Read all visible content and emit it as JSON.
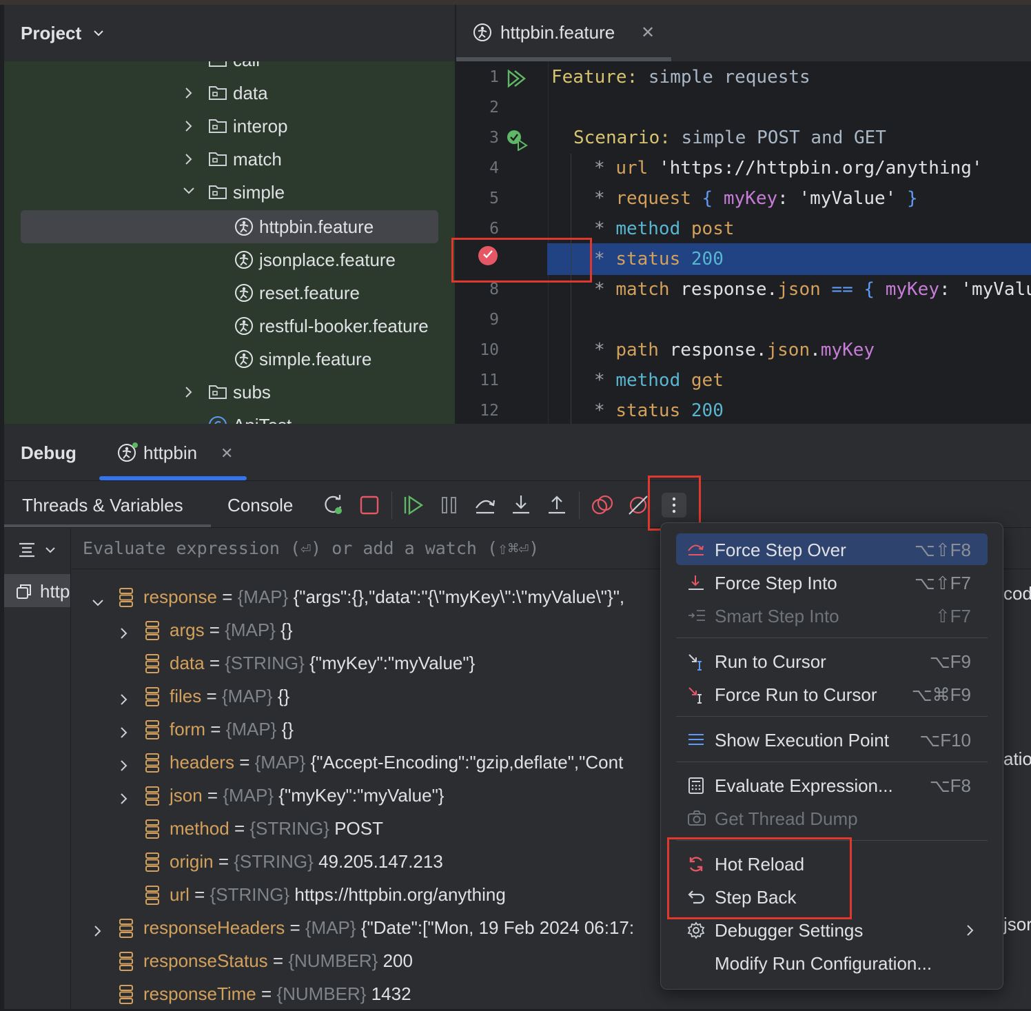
{
  "project": {
    "title": "Project",
    "tree": [
      {
        "label": "call",
        "kind": "folder",
        "clipped": true
      },
      {
        "label": "data",
        "kind": "folder",
        "expanded": false
      },
      {
        "label": "interop",
        "kind": "folder",
        "expanded": false
      },
      {
        "label": "match",
        "kind": "folder",
        "expanded": false
      },
      {
        "label": "simple",
        "kind": "folder",
        "expanded": true
      },
      {
        "label": "httpbin.feature",
        "kind": "feature",
        "selected": true
      },
      {
        "label": "jsonplace.feature",
        "kind": "feature"
      },
      {
        "label": "reset.feature",
        "kind": "feature"
      },
      {
        "label": "restful-booker.feature",
        "kind": "feature"
      },
      {
        "label": "simple.feature",
        "kind": "feature"
      },
      {
        "label": "subs",
        "kind": "folder",
        "expanded": false
      },
      {
        "label": "ApiTest",
        "kind": "class",
        "clipped": true
      }
    ]
  },
  "editor": {
    "tab_label": "httpbin.feature",
    "lines": [
      {
        "n": "1",
        "text": "Feature: simple requests"
      },
      {
        "n": "2",
        "text": ""
      },
      {
        "n": "3",
        "text": "Scenario: simple POST and GET"
      },
      {
        "n": "4",
        "text": "* url 'https://httpbin.org/anything'"
      },
      {
        "n": "5",
        "text": "* request { myKey: 'myValue' }"
      },
      {
        "n": "6",
        "text": "* method post"
      },
      {
        "n": "7",
        "text": "* status 200"
      },
      {
        "n": "8",
        "text": "* match response.json == { myKey: 'myValu"
      },
      {
        "n": "9",
        "text": ""
      },
      {
        "n": "10",
        "text": "* path response.json.myKey"
      },
      {
        "n": "11",
        "text": "* method get"
      },
      {
        "n": "12",
        "text": "* status 200"
      }
    ],
    "tokens": {
      "feature_kw": "Feature:",
      "feature_name": " simple requests",
      "scenario_kw": "Scenario:",
      "scenario_name": " simple POST and GET",
      "star": "*",
      "url": "url",
      "url_val": "'https://httpbin.org/anything'",
      "request": "request",
      "lbrace": "{",
      "rbrace": "}",
      "mykey": "myKey",
      "colon": ":",
      "myvalue": "'myValue'",
      "method": "method",
      "post": "post",
      "get": "get",
      "status": "status",
      "s200": "200",
      "match": "match",
      "response": "response",
      "dot": ".",
      "json": "json",
      "eqeq": "==",
      "myvalu": "'myValu",
      "path": "path",
      "mykey2": "myKey"
    },
    "highlighted_line": "7"
  },
  "debug": {
    "title": "Debug",
    "session_tab": "httpbin",
    "tabs": [
      "Threads & Variables",
      "Console"
    ],
    "eval_placeholder": "Evaluate expression (⏎) or add a watch (⇧⌘⏎)",
    "frame_label": "http",
    "variables": [
      {
        "name": "response",
        "type": "{MAP}",
        "value": "{\"args\":{},\"data\":\"{\\\"myKey\\\":\\\"myValue\\\"}\",",
        "level": 0,
        "expandable": true,
        "expanded": true
      },
      {
        "name": "args",
        "type": "{MAP}",
        "value": "{}",
        "level": 1,
        "expandable": true
      },
      {
        "name": "data",
        "type": "{STRING}",
        "value": "{\"myKey\":\"myValue\"}",
        "level": 1,
        "expandable": false
      },
      {
        "name": "files",
        "type": "{MAP}",
        "value": "{}",
        "level": 1,
        "expandable": true
      },
      {
        "name": "form",
        "type": "{MAP}",
        "value": "{}",
        "level": 1,
        "expandable": true
      },
      {
        "name": "headers",
        "type": "{MAP}",
        "value": "{\"Accept-Encoding\":\"gzip,deflate\",\"Cont",
        "level": 1,
        "expandable": true
      },
      {
        "name": "json",
        "type": "{MAP}",
        "value": "{\"myKey\":\"myValue\"}",
        "level": 1,
        "expandable": true
      },
      {
        "name": "method",
        "type": "{STRING}",
        "value": "POST",
        "level": 1,
        "expandable": false
      },
      {
        "name": "origin",
        "type": "{STRING}",
        "value": "49.205.147.213",
        "level": 1,
        "expandable": false
      },
      {
        "name": "url",
        "type": "{STRING}",
        "value": "https://httpbin.org/anything",
        "level": 1,
        "expandable": false
      },
      {
        "name": "responseHeaders",
        "type": "{MAP}",
        "value": "{\"Date\":[\"Mon, 19 Feb 2024 06:17:",
        "level": 0,
        "expandable": true
      },
      {
        "name": "responseStatus",
        "type": "{NUMBER}",
        "value": "200",
        "level": 0,
        "expandable": false
      },
      {
        "name": "responseTime",
        "type": "{NUMBER}",
        "value": "1432",
        "level": 0,
        "expandable": false
      }
    ],
    "clipped_right": [
      "cod",
      "atio",
      "jsor"
    ]
  },
  "menu": {
    "items": [
      {
        "label": "Force Step Over",
        "shortcut": "⌥⇧F8",
        "active": true
      },
      {
        "label": "Force Step Into",
        "shortcut": "⌥⇧F7"
      },
      {
        "label": "Smart Step Into",
        "shortcut": "⇧F7",
        "disabled": true
      },
      {
        "label": "Run to Cursor",
        "shortcut": "⌥F9"
      },
      {
        "label": "Force Run to Cursor",
        "shortcut": "⌥⌘F9"
      },
      {
        "label": "Show Execution Point",
        "shortcut": "⌥F10"
      },
      {
        "label": "Evaluate Expression...",
        "shortcut": "⌥F8"
      },
      {
        "label": "Get Thread Dump",
        "shortcut": "",
        "disabled": true
      },
      {
        "label": "Hot Reload",
        "shortcut": ""
      },
      {
        "label": "Step Back",
        "shortcut": ""
      },
      {
        "label": "Debugger Settings",
        "shortcut": "",
        "submenu": true
      },
      {
        "label": "Modify Run Configuration...",
        "shortcut": ""
      }
    ]
  },
  "colors": {
    "accent": "#3574f0",
    "highlight_line": "#214283",
    "annotation_red": "#e0382d",
    "breakpoint": "#e55765",
    "variable_name": "#d4a15c"
  }
}
